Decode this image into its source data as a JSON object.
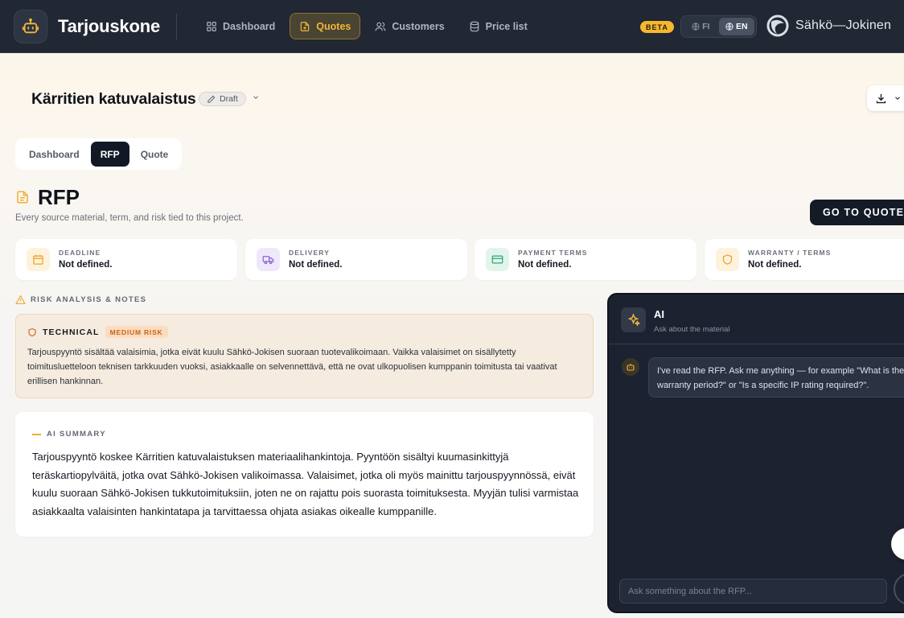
{
  "app": {
    "brand": "Tarjouskone",
    "nav": [
      {
        "label": "Dashboard",
        "icon": "grid-icon",
        "active": false
      },
      {
        "label": "Quotes",
        "icon": "document-icon",
        "active": true
      },
      {
        "label": "Customers",
        "icon": "users-icon",
        "active": false
      },
      {
        "label": "Price list",
        "icon": "database-icon",
        "active": false
      }
    ],
    "beta_label": "BETA",
    "languages": [
      {
        "label": "FI",
        "active": false
      },
      {
        "label": "EN",
        "active": true
      }
    ],
    "company_name": "Sähkö—Jokinen"
  },
  "project": {
    "title": "Kärritien katuvalaistus",
    "status": "Draft"
  },
  "tabs": [
    {
      "label": "Dashboard",
      "active": false
    },
    {
      "label": "RFP",
      "active": true
    },
    {
      "label": "Quote",
      "active": false
    }
  ],
  "rfp": {
    "title": "RFP",
    "subtitle": "Every source material, term, and risk tied to this project.",
    "go_to_quote": "GO TO QUOTE"
  },
  "info_cards": [
    {
      "label": "DEADLINE",
      "value": "Not defined.",
      "icon": "calendar-icon",
      "accent": "#f0a12a",
      "bg": "#fdf2dc"
    },
    {
      "label": "DELIVERY",
      "value": "Not defined.",
      "icon": "truck-icon",
      "accent": "#8a63d2",
      "bg": "#efe8fb"
    },
    {
      "label": "PAYMENT TERMS",
      "value": "Not defined.",
      "icon": "credit-card-icon",
      "accent": "#2fa776",
      "bg": "#e2f5ec"
    },
    {
      "label": "WARRANTY / TERMS",
      "value": "Not defined.",
      "icon": "shield-icon",
      "accent": "#f0a12a",
      "bg": "#fdf2dc"
    }
  ],
  "risk": {
    "heading": "RISK ANALYSIS & NOTES",
    "items": [
      {
        "type": "TECHNICAL",
        "level": "MEDIUM RISK",
        "text": "Tarjouspyyntö sisältää valaisimia, jotka eivät kuulu Sähkö-Jokisen suoraan tuotevalikoimaan. Vaikka valaisimet on sisällytetty toimitusluetteloon teknisen tarkkuuden vuoksi, asiakkaalle on selvennettävä, että ne ovat ulkopuolisen kumppanin toimitusta tai vaativat erillisen hankinnan."
      }
    ]
  },
  "summary": {
    "label": "AI SUMMARY",
    "text": "Tarjouspyyntö koskee Kärritien katuvalaistuksen materiaalihankintoja. Pyyntöön sisältyi kuumasinkittyjä teräskartiopylväitä, jotka ovat Sähkö-Jokisen valikoimassa. Valaisimet, jotka oli myös mainittu tarjouspyynnössä, eivät kuulu suoraan Sähkö-Jokisen tukkutoimituksiin, joten ne on rajattu pois suorasta toimituksesta. Myyjän tulisi varmistaa asiakkaalta valaisinten hankintatapa ja tarvittaessa ohjata asiakas oikealle kumppanille."
  },
  "ai": {
    "title": "AI",
    "subtitle": "Ask about the material",
    "message": "I've read the RFP. Ask me anything — for example \"What is the warranty period?\" or \"Is a specific IP rating required?\".",
    "input_placeholder": "Ask something about the RFP..."
  },
  "colors": {
    "topbar": "#212733",
    "accent": "#f2b63a",
    "dark_button": "#141a26"
  }
}
